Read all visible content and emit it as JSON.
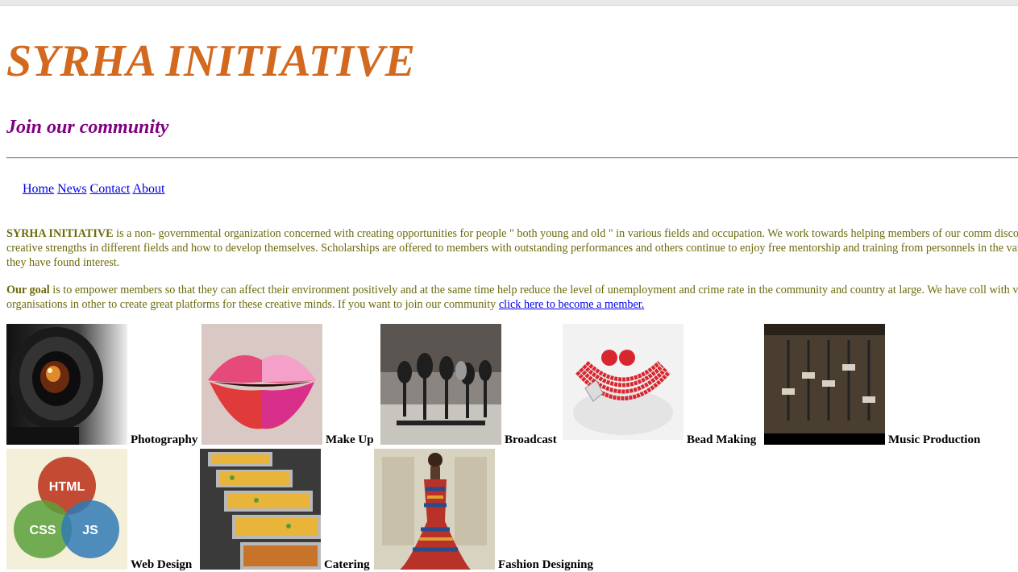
{
  "header": {
    "title": "SYRHA INITIATIVE",
    "tagline": "Join our community"
  },
  "nav": {
    "items": [
      {
        "label": "Home"
      },
      {
        "label": "News"
      },
      {
        "label": "Contact"
      },
      {
        "label": "About"
      }
    ]
  },
  "intro": {
    "org_name": "SYRHA INITIATIVE",
    "text": " is a non- governmental organization concerned with creating opportunities for people \" both young and old \" in various fields and occupation. We work towards helping members of our comm discover their creative strengths in different fields and how to develop themselves. Scholarships are offered to members with outstanding performances and others continue to enjoy free mentorship and training from personnels in the various fields they have found interest."
  },
  "goal": {
    "heading": "Our goal",
    "text": " is to empower members so that they can affect their environment positively and at the same time help reduce the level of unemployment and crime rate in the community and country at large. We have coll with various organisations in other to create great platforms for these creative minds. If you want to join our community ",
    "link_label": "click here to become a member."
  },
  "gallery": {
    "items": [
      {
        "label": "Photography",
        "icon": "camera-lens-image"
      },
      {
        "label": "Make Up",
        "icon": "lips-image"
      },
      {
        "label": "Broadcast",
        "icon": "microphones-image"
      },
      {
        "label": "Bead Making",
        "icon": "bead-necklace-image"
      },
      {
        "label": "Music Production",
        "icon": "mixing-console-image"
      },
      {
        "label": "Web Design",
        "icon": "html-css-js-venn-image",
        "venn": [
          "HTML",
          "CSS",
          "JS"
        ]
      },
      {
        "label": "Catering",
        "icon": "food-trays-image"
      },
      {
        "label": "Fashion Designing",
        "icon": "fashion-dress-image"
      }
    ]
  },
  "colors": {
    "title": "#d2691e",
    "tagline": "#800080",
    "body_text": "#6b6b0c",
    "link": "#0000ee"
  }
}
